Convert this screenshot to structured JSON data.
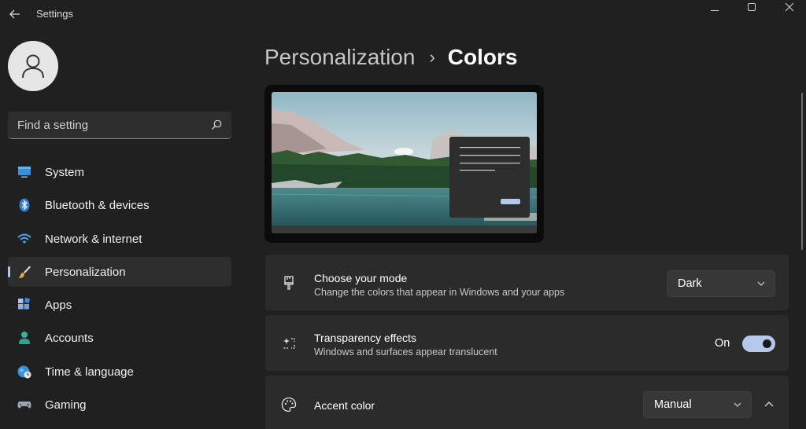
{
  "window": {
    "title": "Settings",
    "controls": [
      "minimize",
      "maximize",
      "close"
    ]
  },
  "sidebar": {
    "search": {
      "placeholder": "Find a setting",
      "value": ""
    },
    "items": [
      {
        "label": "System",
        "icon": "monitor-icon"
      },
      {
        "label": "Bluetooth & devices",
        "icon": "bluetooth-icon"
      },
      {
        "label": "Network & internet",
        "icon": "wifi-icon"
      },
      {
        "label": "Personalization",
        "icon": "brush-icon",
        "active": true
      },
      {
        "label": "Apps",
        "icon": "apps-icon"
      },
      {
        "label": "Accounts",
        "icon": "person-icon"
      },
      {
        "label": "Time & language",
        "icon": "globe-clock-icon"
      },
      {
        "label": "Gaming",
        "icon": "gamepad-icon"
      }
    ]
  },
  "breadcrumb": {
    "parent": "Personalization",
    "separator": "›",
    "current": "Colors"
  },
  "settings": {
    "mode": {
      "title": "Choose your mode",
      "subtitle": "Change the colors that appear in Windows and your apps",
      "value": "Dark"
    },
    "transparency": {
      "title": "Transparency effects",
      "subtitle": "Windows and surfaces appear translucent",
      "state_label": "On",
      "enabled": true
    },
    "accent": {
      "title": "Accent color",
      "value": "Manual",
      "expanded": true
    }
  },
  "colors": {
    "background": "#202020",
    "card": "#2b2b2b",
    "accent": "#b3c8ea"
  }
}
